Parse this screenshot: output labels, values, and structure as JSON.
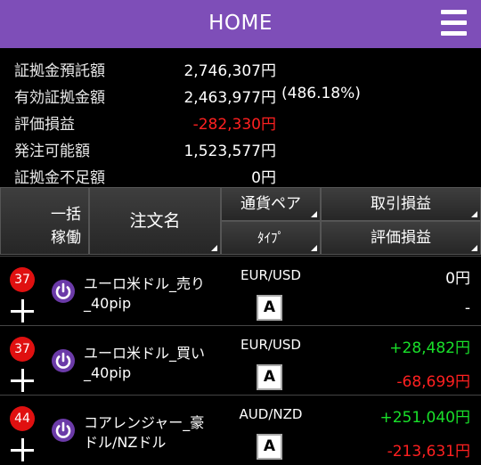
{
  "header": {
    "title": "HOME",
    "menu_icon": "hamburger-menu-icon"
  },
  "summary": [
    {
      "label": "証拠金預託額",
      "value": "2,746,307円",
      "extra": ""
    },
    {
      "label": "有効証拠金額",
      "value": "2,463,977円",
      "extra": "(486.18%)"
    },
    {
      "label": "評価損益",
      "value": "-282,330円",
      "extra": ""
    },
    {
      "label": "発注可能額",
      "value": "1,523,577円",
      "extra": ""
    },
    {
      "label": "証拠金不足額",
      "value": "0円",
      "extra": ""
    }
  ],
  "table_header": {
    "bulk_line1": "一括",
    "bulk_line2": "稼働",
    "order_name": "注文名",
    "currency_pair": "通貨ペア",
    "type": "ﾀｲﾌﾟ",
    "trade_pl": "取引損益",
    "eval_pl": "評価損益"
  },
  "rows": [
    {
      "count": "37",
      "name": "ユーロ米ドル_売り_40pip",
      "pair": "EUR/USD",
      "type": "A",
      "trade_pl": "0円",
      "eval_pl": "-"
    },
    {
      "count": "37",
      "name": "ユーロ米ドル_買い_40pip",
      "pair": "EUR/USD",
      "type": "A",
      "trade_pl": "+28,482円",
      "eval_pl": "-68,699円"
    },
    {
      "count": "44",
      "name": "コアレンジャー_豪ドル/NZドル",
      "pair": "AUD/NZD",
      "type": "A",
      "trade_pl": "+251,040円",
      "eval_pl": "-213,631円"
    }
  ],
  "colors": {
    "header_bg": "#7e4eb8",
    "negative": "#ff2020",
    "positive": "#19e02a",
    "badge": "#e01010",
    "power_icon": "#6b3aa8"
  }
}
